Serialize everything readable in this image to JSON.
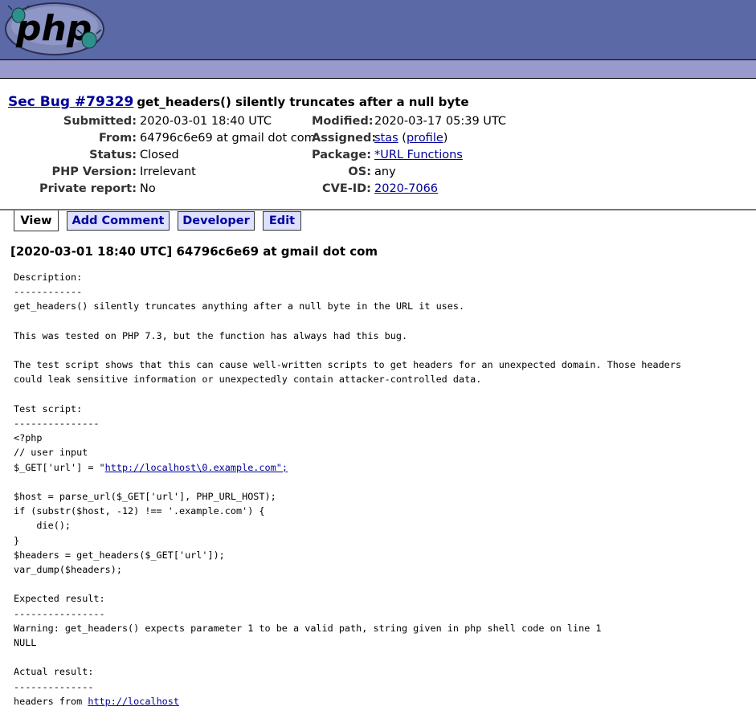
{
  "bug": {
    "type_label": "Sec Bug",
    "number_label": "#79329",
    "summary": "get_headers() silently truncates after a null byte"
  },
  "meta_left": [
    {
      "key": "Submitted:",
      "value": "2020-03-01 18:40 UTC"
    },
    {
      "key": "From:",
      "value": "64796c6e69 at gmail dot com"
    },
    {
      "key": "Status:",
      "value": "Closed"
    },
    {
      "key": "PHP Version:",
      "value": "Irrelevant"
    },
    {
      "key": "Private report:",
      "value": "No"
    }
  ],
  "meta_right": {
    "modified_key": "Modified:",
    "modified_value": "2020-03-17 05:39 UTC",
    "assigned_key": "Assigned:",
    "assigned_user": "stas",
    "assigned_profile": "profile",
    "assigned_open": "(",
    "assigned_close": ")",
    "package_key": "Package:",
    "package_value": "*URL Functions",
    "os_key": "OS:",
    "os_value": "any",
    "cve_key": "CVE-ID:",
    "cve_value": "2020-7066"
  },
  "tabs": [
    {
      "label": "View",
      "active": true
    },
    {
      "label": "Add Comment",
      "active": false
    },
    {
      "label": "Developer",
      "active": false
    },
    {
      "label": "Edit",
      "active": false
    }
  ],
  "comment": {
    "header": "[2020-03-01 18:40 UTC] 64796c6e69 at gmail dot com",
    "text_1": "Description:\n------------\nget_headers() silently truncates anything after a null byte in the URL it uses.\n\nThis was tested on PHP 7.3, but the function has always had this bug.\n\nThe test script shows that this can cause well-written scripts to get headers for an unexpected domain. Those headers\ncould leak sensitive information or unexpectedly contain attacker-controlled data.\n\nTest script:\n---------------\n<?php\n// user input\n$_GET['url'] = \"",
    "link_1": "http://localhost\\0.example.com\";",
    "text_2": "\n\n$host = parse_url($_GET['url'], PHP_URL_HOST);\nif (substr($host, -12) !== '.example.com') {\n    die();\n}\n$headers = get_headers($_GET['url']);\nvar_dump($headers);\n\nExpected result:\n----------------\nWarning: get_headers() expects parameter 1 to be a valid path, string given in php shell code on line 1\nNULL\n\nActual result:\n--------------\nheaders from ",
    "link_2": "http://localhost"
  }
}
